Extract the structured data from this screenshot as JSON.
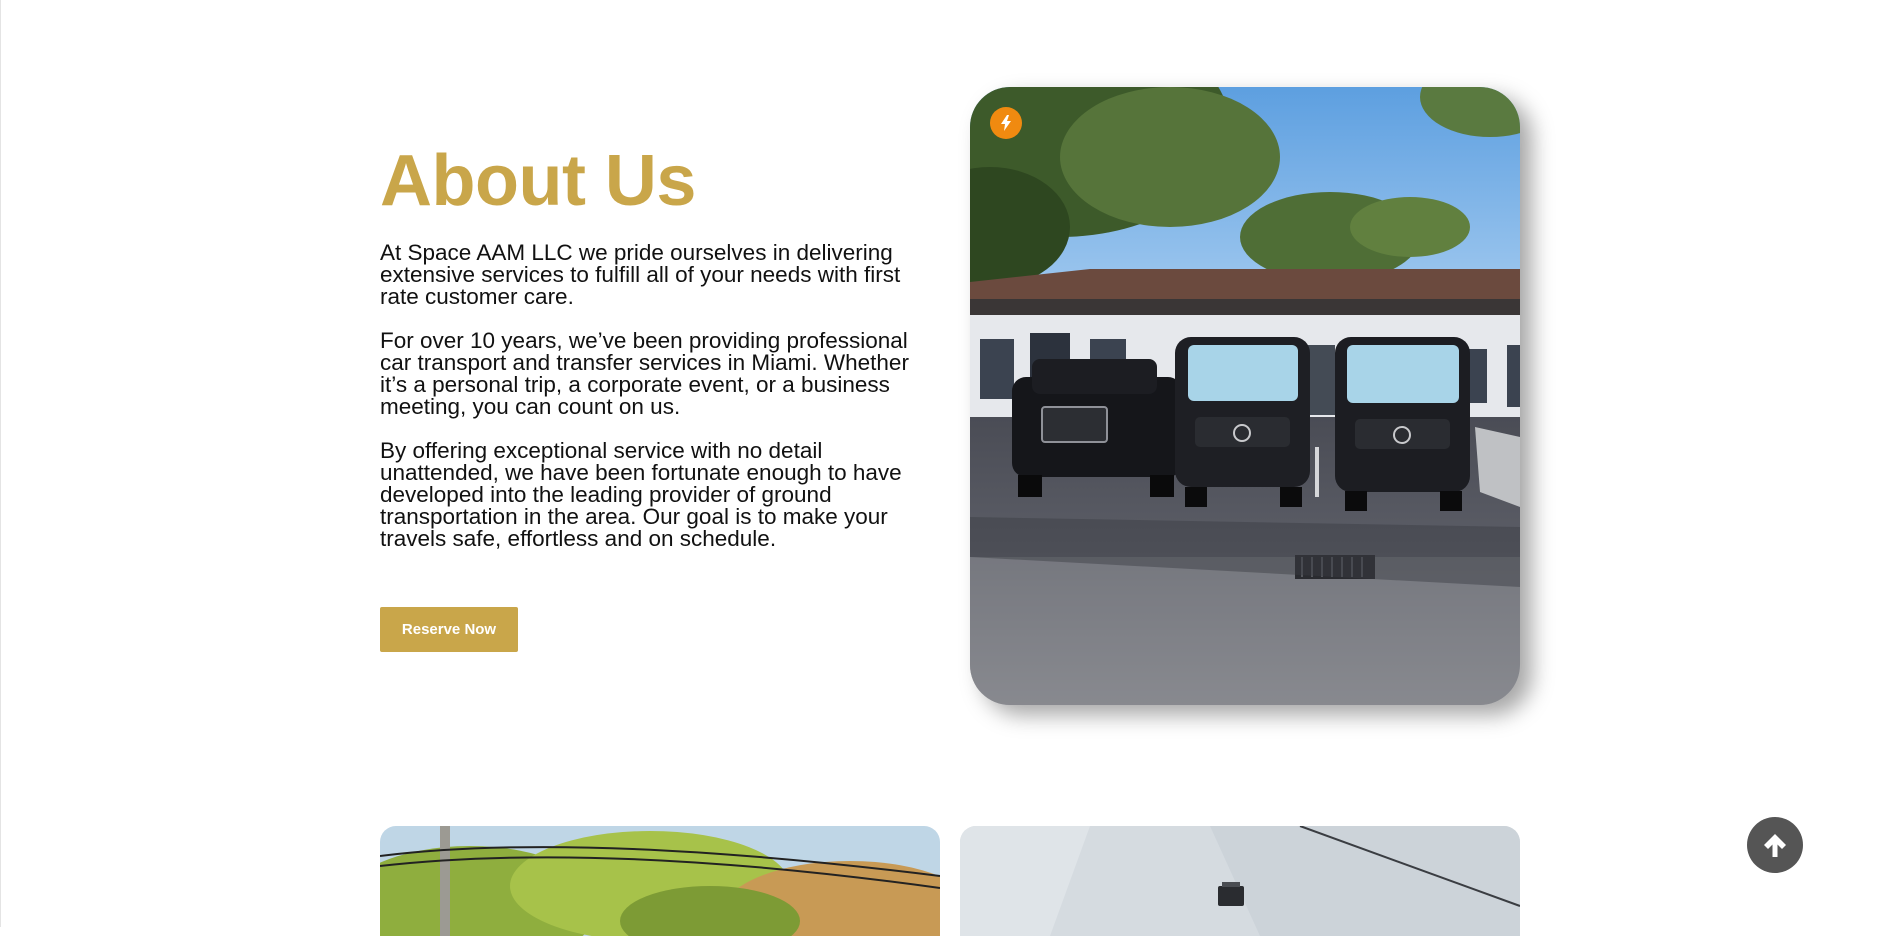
{
  "about": {
    "title": "About Us",
    "paragraphs": [
      "At Space AAM LLC we pride ourselves in delivering extensive services to fulfill all of your needs with first rate customer care.",
      "For over 10 years, we’ve been providing professional car transport and transfer services in Miami. Whether it’s a personal trip, a corporate event, or a business meeting, you can count on us.",
      "By offering exceptional service with no detail unattended, we have been fortunate enough to have developed into the leading provider of ground transportation in the area. Our goal is to make your travels safe, effortless and on schedule."
    ],
    "button_label": "Reserve Now"
  },
  "colors": {
    "accent": "#c9a64a",
    "badge": "#f08a10",
    "scroll_button": "#555555"
  },
  "icons": {
    "badge": "lightning-icon",
    "scroll_top": "arrow-up-icon"
  }
}
